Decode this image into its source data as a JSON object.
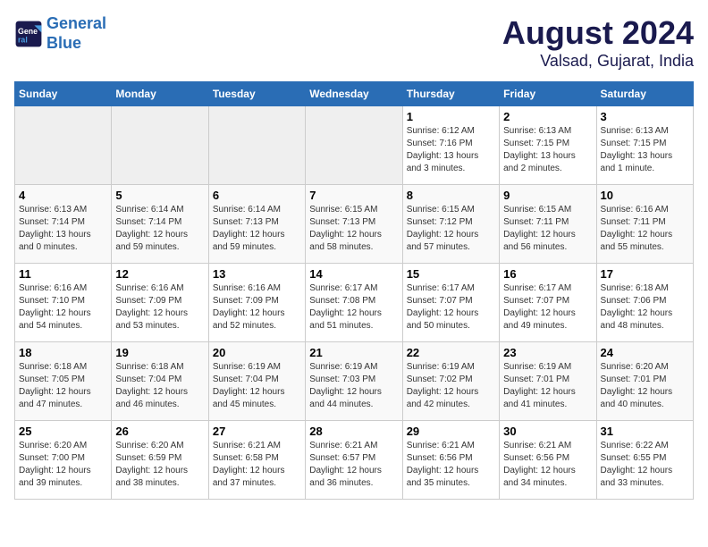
{
  "header": {
    "logo_line1": "General",
    "logo_line2": "Blue",
    "month": "August 2024",
    "location": "Valsad, Gujarat, India"
  },
  "days_of_week": [
    "Sunday",
    "Monday",
    "Tuesday",
    "Wednesday",
    "Thursday",
    "Friday",
    "Saturday"
  ],
  "weeks": [
    [
      {
        "day": "",
        "empty": true
      },
      {
        "day": "",
        "empty": true
      },
      {
        "day": "",
        "empty": true
      },
      {
        "day": "",
        "empty": true
      },
      {
        "day": "1",
        "sunrise": "6:12 AM",
        "sunset": "7:16 PM",
        "daylight": "13 hours and 3 minutes."
      },
      {
        "day": "2",
        "sunrise": "6:13 AM",
        "sunset": "7:15 PM",
        "daylight": "13 hours and 2 minutes."
      },
      {
        "day": "3",
        "sunrise": "6:13 AM",
        "sunset": "7:15 PM",
        "daylight": "13 hours and 1 minute."
      }
    ],
    [
      {
        "day": "4",
        "sunrise": "6:13 AM",
        "sunset": "7:14 PM",
        "daylight": "13 hours and 0 minutes."
      },
      {
        "day": "5",
        "sunrise": "6:14 AM",
        "sunset": "7:14 PM",
        "daylight": "12 hours and 59 minutes."
      },
      {
        "day": "6",
        "sunrise": "6:14 AM",
        "sunset": "7:13 PM",
        "daylight": "12 hours and 59 minutes."
      },
      {
        "day": "7",
        "sunrise": "6:15 AM",
        "sunset": "7:13 PM",
        "daylight": "12 hours and 58 minutes."
      },
      {
        "day": "8",
        "sunrise": "6:15 AM",
        "sunset": "7:12 PM",
        "daylight": "12 hours and 57 minutes."
      },
      {
        "day": "9",
        "sunrise": "6:15 AM",
        "sunset": "7:11 PM",
        "daylight": "12 hours and 56 minutes."
      },
      {
        "day": "10",
        "sunrise": "6:16 AM",
        "sunset": "7:11 PM",
        "daylight": "12 hours and 55 minutes."
      }
    ],
    [
      {
        "day": "11",
        "sunrise": "6:16 AM",
        "sunset": "7:10 PM",
        "daylight": "12 hours and 54 minutes."
      },
      {
        "day": "12",
        "sunrise": "6:16 AM",
        "sunset": "7:09 PM",
        "daylight": "12 hours and 53 minutes."
      },
      {
        "day": "13",
        "sunrise": "6:16 AM",
        "sunset": "7:09 PM",
        "daylight": "12 hours and 52 minutes."
      },
      {
        "day": "14",
        "sunrise": "6:17 AM",
        "sunset": "7:08 PM",
        "daylight": "12 hours and 51 minutes."
      },
      {
        "day": "15",
        "sunrise": "6:17 AM",
        "sunset": "7:07 PM",
        "daylight": "12 hours and 50 minutes."
      },
      {
        "day": "16",
        "sunrise": "6:17 AM",
        "sunset": "7:07 PM",
        "daylight": "12 hours and 49 minutes."
      },
      {
        "day": "17",
        "sunrise": "6:18 AM",
        "sunset": "7:06 PM",
        "daylight": "12 hours and 48 minutes."
      }
    ],
    [
      {
        "day": "18",
        "sunrise": "6:18 AM",
        "sunset": "7:05 PM",
        "daylight": "12 hours and 47 minutes."
      },
      {
        "day": "19",
        "sunrise": "6:18 AM",
        "sunset": "7:04 PM",
        "daylight": "12 hours and 46 minutes."
      },
      {
        "day": "20",
        "sunrise": "6:19 AM",
        "sunset": "7:04 PM",
        "daylight": "12 hours and 45 minutes."
      },
      {
        "day": "21",
        "sunrise": "6:19 AM",
        "sunset": "7:03 PM",
        "daylight": "12 hours and 44 minutes."
      },
      {
        "day": "22",
        "sunrise": "6:19 AM",
        "sunset": "7:02 PM",
        "daylight": "12 hours and 42 minutes."
      },
      {
        "day": "23",
        "sunrise": "6:19 AM",
        "sunset": "7:01 PM",
        "daylight": "12 hours and 41 minutes."
      },
      {
        "day": "24",
        "sunrise": "6:20 AM",
        "sunset": "7:01 PM",
        "daylight": "12 hours and 40 minutes."
      }
    ],
    [
      {
        "day": "25",
        "sunrise": "6:20 AM",
        "sunset": "7:00 PM",
        "daylight": "12 hours and 39 minutes."
      },
      {
        "day": "26",
        "sunrise": "6:20 AM",
        "sunset": "6:59 PM",
        "daylight": "12 hours and 38 minutes."
      },
      {
        "day": "27",
        "sunrise": "6:21 AM",
        "sunset": "6:58 PM",
        "daylight": "12 hours and 37 minutes."
      },
      {
        "day": "28",
        "sunrise": "6:21 AM",
        "sunset": "6:57 PM",
        "daylight": "12 hours and 36 minutes."
      },
      {
        "day": "29",
        "sunrise": "6:21 AM",
        "sunset": "6:56 PM",
        "daylight": "12 hours and 35 minutes."
      },
      {
        "day": "30",
        "sunrise": "6:21 AM",
        "sunset": "6:56 PM",
        "daylight": "12 hours and 34 minutes."
      },
      {
        "day": "31",
        "sunrise": "6:22 AM",
        "sunset": "6:55 PM",
        "daylight": "12 hours and 33 minutes."
      }
    ]
  ]
}
